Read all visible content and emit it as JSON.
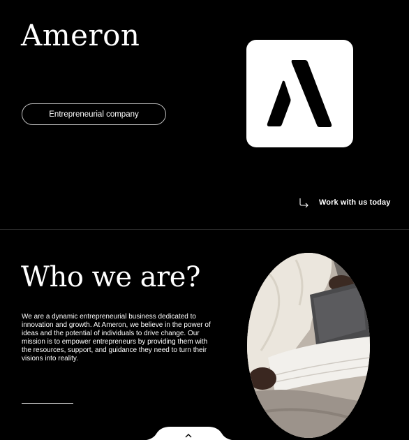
{
  "hero": {
    "brand": "Ameron",
    "tag_label": "Entrepreneurial company",
    "cta_label": "Work with us today"
  },
  "about": {
    "heading": "Who we are?",
    "paragraph": "We are a dynamic entrepreneurial business dedicated to innovation and growth. At Ameron, we believe in the power of ideas and the potential of individuals to drive change. Our mission is to empower entrepreneurs by providing them with the resources, support, and guidance they need to turn their visions into reality."
  },
  "icons": {
    "logo": "ameron-logo-mark",
    "cta": "arrow-turn-right-icon",
    "scroll": "chevron-up-icon"
  },
  "colors": {
    "background": "#000000",
    "text": "#ffffff",
    "logo_bg": "#ffffff",
    "logo_mark": "#000000"
  }
}
